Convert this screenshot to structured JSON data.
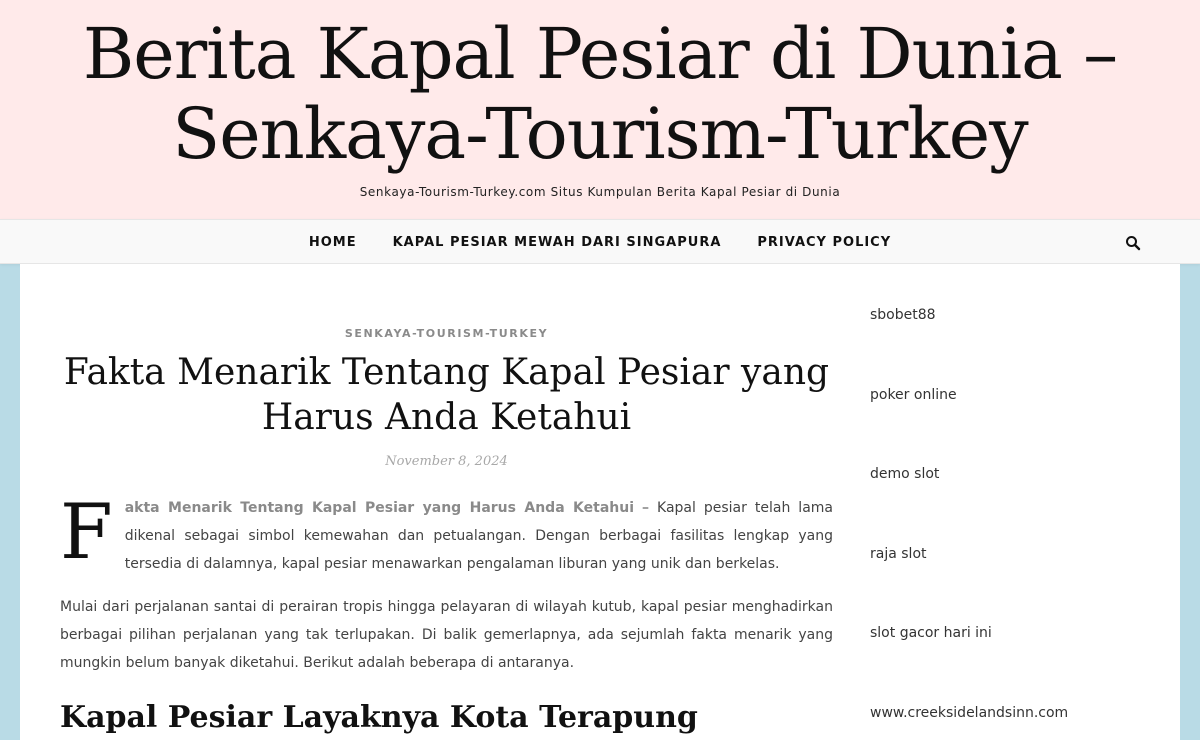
{
  "header": {
    "title_line1": "Berita Kapal Pesiar di Dunia –",
    "title_line2": "Senkaya-Tourism-Turkey",
    "tagline": "Senkaya-Tourism-Turkey.com Situs Kumpulan Berita Kapal Pesiar di Dunia"
  },
  "nav": {
    "items": [
      "HOME",
      "KAPAL PESIAR MEWAH DARI SINGAPURA",
      "PRIVACY POLICY"
    ],
    "search_icon": "search-icon"
  },
  "post": {
    "category": "SENKAYA-TOURISM-TURKEY",
    "title_line1": "Fakta Menarik Tentang Kapal Pesiar yang",
    "title_line2": "Harus Anda Ketahui",
    "date": "November 8, 2024",
    "drop_cap": "F",
    "lead_strong": "akta Menarik Tentang Kapal Pesiar yang Harus Anda Ketahui",
    "lead_rest": " – Kapal pesiar telah lama dikenal sebagai simbol kemewahan dan petualangan. Dengan berbagai fasilitas lengkap yang tersedia di dalamnya, kapal pesiar menawarkan pengalaman liburan yang unik dan berkelas.",
    "paragraph_2": "Mulai dari perjalanan santai di perairan tropis hingga pelayaran di wilayah kutub, kapal pesiar menghadirkan berbagai pilihan perjalanan yang tak terlupakan. Di balik gemerlapnya, ada sejumlah fakta menarik yang mungkin belum banyak diketahui. Berikut adalah beberapa di antaranya.",
    "subheading": "Kapal Pesiar Layaknya Kota Terapung"
  },
  "sidebar": {
    "links": [
      "sbobet88",
      "poker online",
      "demo slot",
      "raja slot",
      "slot gacor hari ini",
      "www.creeksidelandsinn.com"
    ]
  },
  "colors": {
    "header_bg": "#ffeaea",
    "page_bg": "#b9dbe6",
    "muted_text": "#8a8a8a"
  }
}
